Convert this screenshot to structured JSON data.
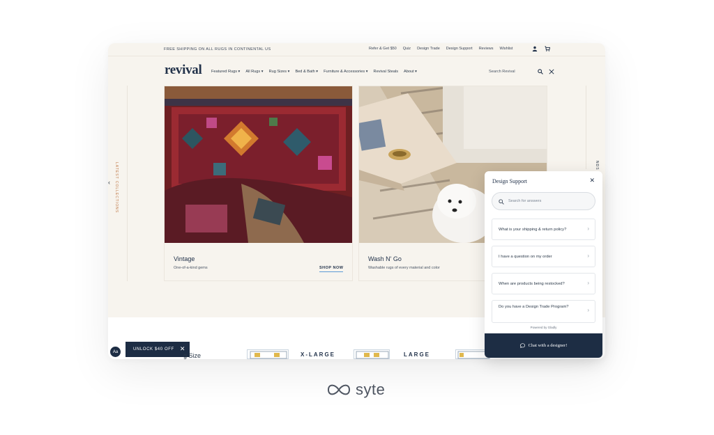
{
  "topbar": {
    "promo": "FREE SHIPPING ON ALL RUGS IN CONTINENTAL US",
    "links": [
      "Refer & Get $50",
      "Quiz",
      "Design Trade",
      "Design Support",
      "Reviews",
      "Wishlist"
    ],
    "icons": [
      "user-icon",
      "cart-icon"
    ]
  },
  "nav": {
    "logo": "revival",
    "menu": [
      "Featured Rugs ▾",
      "All Rugs ▾",
      "Rug Sizes ▾",
      "Bed & Bath ▾",
      "Furniture & Accessories ▾",
      "Revival Steals",
      "About ▾"
    ],
    "search_label": "Search Revival",
    "icons": [
      "search-icon",
      "close-icon"
    ]
  },
  "side_tab": {
    "label": "LATEST COLLECTIONS"
  },
  "side_tab_right": {
    "label": "NDS"
  },
  "cards": [
    {
      "title": "Vintage",
      "subtitle": "One-of-a-kind gems",
      "cta": "SHOP NOW"
    },
    {
      "title": "Wash N' Go",
      "subtitle": "Washable rugs of every material and color"
    }
  ],
  "lower": {
    "aa": "Aa",
    "unlock": "UNLOCK $40 OFF",
    "unlock_close": "✕",
    "size_label": "g Size",
    "sizes": [
      "X-LARGE",
      "LARGE"
    ]
  },
  "chat": {
    "title": "Design Support",
    "close": "✕",
    "search_placeholder": "Search for answers",
    "faqs": [
      "What is your shipping & return policy?",
      "I have a question on my order",
      "When are products being restocked?",
      "Do you have a Design Trade Program?"
    ],
    "powered_by": "Powered by Gladly",
    "cta": "Chat with a designer!"
  },
  "footer": {
    "brand": "syte"
  },
  "colors": {
    "navy": "#1d2d44",
    "cream": "#f7f4ee",
    "accent": "#c07a49"
  }
}
